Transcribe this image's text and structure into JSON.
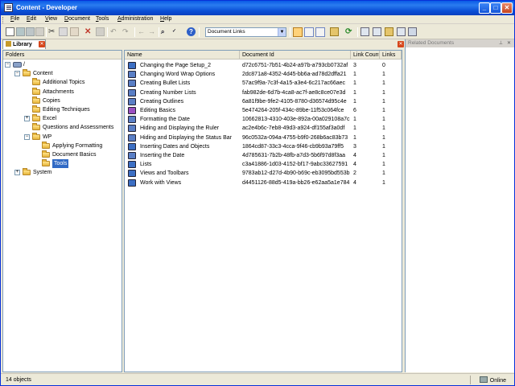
{
  "window": {
    "title": "Content - Developer"
  },
  "menu": [
    "File",
    "Edit",
    "View",
    "Document",
    "Tools",
    "Administration",
    "Help"
  ],
  "toolbar": {
    "doc_select": "Document Links"
  },
  "tabs": {
    "library": "Library"
  },
  "folders": {
    "header": "Folders",
    "tree": [
      {
        "label": "/",
        "depth": 0,
        "expander": "-",
        "type": "root"
      },
      {
        "label": "Content",
        "depth": 1,
        "expander": "-"
      },
      {
        "label": "Additional Topics",
        "depth": 2
      },
      {
        "label": "Attachments",
        "depth": 2
      },
      {
        "label": "Copies",
        "depth": 2
      },
      {
        "label": "Editing Techniques",
        "depth": 2
      },
      {
        "label": "Excel",
        "depth": 2,
        "expander": "+"
      },
      {
        "label": "Questions and Assessments",
        "depth": 2
      },
      {
        "label": "WP",
        "depth": 2,
        "expander": "-"
      },
      {
        "label": "Applying Formatting",
        "depth": 3
      },
      {
        "label": "Document Basics",
        "depth": 3
      },
      {
        "label": "Tools",
        "depth": 3,
        "selected": true
      },
      {
        "label": "System",
        "depth": 1,
        "expander": "+"
      }
    ]
  },
  "list": {
    "columns": [
      "Name",
      "Document Id",
      "Link Count",
      "Links"
    ],
    "rows": [
      {
        "icon": "module",
        "name": "Changing the Page Setup_2",
        "id": "d72c6751-7b51-4b24-a97b-a793cb0732af",
        "count": "3",
        "links": "0"
      },
      {
        "icon": "topic",
        "name": "Changing Word Wrap Options",
        "id": "2dc871a8-4352-4d45-bb6a-ad78d2dffa21",
        "count": "1",
        "links": "1"
      },
      {
        "icon": "topic",
        "name": "Creating Bullet Lists",
        "id": "57ac9f9a-7c3f-4a15-a3e4-6c217ac66aec",
        "count": "1",
        "links": "1"
      },
      {
        "icon": "topic",
        "name": "Creating Number Lists",
        "id": "fab982de-6d7b-4ca8-ac7f-ae8c8ce07e3d",
        "count": "1",
        "links": "1"
      },
      {
        "icon": "topic",
        "name": "Creating Outlines",
        "id": "6a81f9be-9fe2-4105-8780-d36574d95c4e",
        "count": "1",
        "links": "1"
      },
      {
        "icon": "section",
        "name": "Editing Basics",
        "id": "5e474264-205f-434c-89be-11f53c064fce",
        "count": "6",
        "links": "1"
      },
      {
        "icon": "topic",
        "name": "Formatting the Date",
        "id": "10662813-4310-403e-892a-00a029108a7c",
        "count": "1",
        "links": "1"
      },
      {
        "icon": "topic",
        "name": "Hiding and Displaying the Ruler",
        "id": "ac2e4b6c-7eb8-49d3-a924-df155af3a0df",
        "count": "1",
        "links": "1"
      },
      {
        "icon": "topic",
        "name": "Hiding and Displaying the Status Bar",
        "id": "96c0532a-094a-4755-b9f0-268b6ac83b73",
        "count": "1",
        "links": "1"
      },
      {
        "icon": "module",
        "name": "Inserting Dates and Objects",
        "id": "1864cd87-33c3-4cca-9f46-cb9b93a79ff5",
        "count": "3",
        "links": "1"
      },
      {
        "icon": "topic",
        "name": "Inserting the Date",
        "id": "4d785631-7b2b-48fb-a7d3-5b6f97d8f3aa",
        "count": "4",
        "links": "1"
      },
      {
        "icon": "module",
        "name": "Lists",
        "id": "c3a41886-1d03-4152-bf17-9abc33627591",
        "count": "4",
        "links": "1"
      },
      {
        "icon": "module",
        "name": "Views and Toolbars",
        "id": "9783ab12-d27d-4b90-b69c-eb3095bd553b",
        "count": "2",
        "links": "1"
      },
      {
        "icon": "module",
        "name": "Work with Views",
        "id": "d4451126-88d5-419a-bb26-e62aa5a1e784",
        "count": "4",
        "links": "1"
      }
    ]
  },
  "related": {
    "title": "Related Documents"
  },
  "status": {
    "count": "14 objects",
    "connection": "Online"
  },
  "colors": {
    "title_bar": "#0a5ae6",
    "selection": "#316ac5",
    "close": "#d6471c"
  }
}
